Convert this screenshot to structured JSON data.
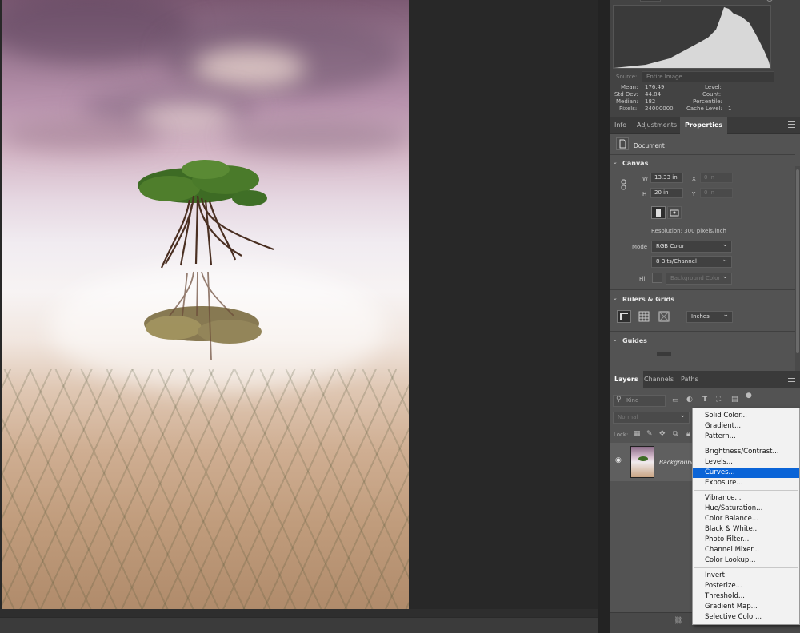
{
  "histogram": {
    "source_label": "Source:",
    "source_value": "Entire Image",
    "mean_label": "Mean:",
    "mean_value": "176.49",
    "stddev_label": "Std Dev:",
    "stddev_value": "44.84",
    "median_label": "Median:",
    "median_value": "182",
    "pixels_label": "Pixels:",
    "pixels_value": "24000000",
    "level_label": "Level:",
    "count_label": "Count:",
    "percentile_label": "Percentile:",
    "cache_label": "Cache Level:",
    "cache_value": "1"
  },
  "properties_tabs": [
    "Info",
    "Adjustments",
    "Properties"
  ],
  "properties": {
    "document_label": "Document",
    "canvas": {
      "title": "Canvas",
      "w_label": "W",
      "w_value": "13.33 in",
      "h_label": "H",
      "h_value": "20 in",
      "x_label": "X",
      "x_value": "0 in",
      "y_label": "Y",
      "y_value": "0 in",
      "resolution": "Resolution: 300 pixels/inch",
      "mode_label": "Mode",
      "mode_value": "RGB Color",
      "bits_value": "8 Bits/Channel",
      "fill_label": "Fill",
      "fill_value": "Background Color"
    },
    "rulers": {
      "title": "Rulers & Grids",
      "units_value": "Inches"
    },
    "guides": {
      "title": "Guides"
    }
  },
  "layers_tabs": [
    "Layers",
    "Channels",
    "Paths"
  ],
  "layers": {
    "kind_placeholder": "Kind",
    "blend_mode": "Normal",
    "lock_label": "Lock:",
    "layer_name": "Background"
  },
  "context_menu": {
    "items": [
      "Solid Color...",
      "Gradient...",
      "Pattern...",
      "Brightness/Contrast...",
      "Levels...",
      "Curves...",
      "Exposure...",
      "Vibrance...",
      "Hue/Saturation...",
      "Color Balance...",
      "Black & White...",
      "Photo Filter...",
      "Channel Mixer...",
      "Color Lookup...",
      "Invert",
      "Posterize...",
      "Threshold...",
      "Gradient Map...",
      "Selective Color..."
    ],
    "highlighted": "Curves..."
  },
  "colors": {
    "highlight": "#0a64d7",
    "panel": "#535353",
    "panel_dark": "#434343"
  }
}
